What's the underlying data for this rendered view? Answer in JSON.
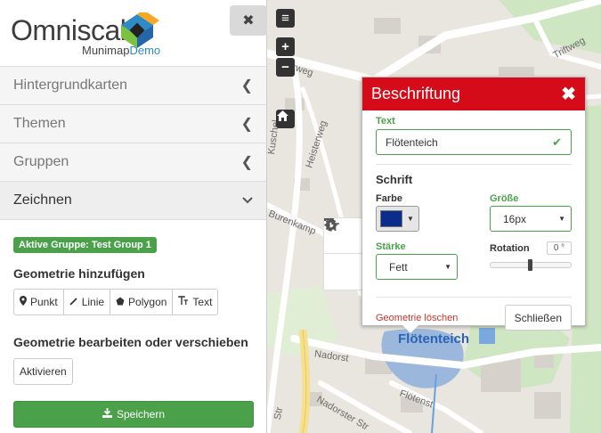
{
  "app": {
    "logo_main": "Omniscale",
    "logo_sub_prefix": "Munimap",
    "logo_sub_suffix": "Demo"
  },
  "colors": {
    "accent_red": "#d60b19",
    "success_green": "#4aa14a",
    "selected_color": "#0b2c8a"
  },
  "sidebar": {
    "close_icon": "times-icon",
    "sections": [
      {
        "label": "Hintergrundkarten",
        "icon": "chevron-left-icon"
      },
      {
        "label": "Themen",
        "icon": "chevron-left-icon"
      },
      {
        "label": "Gruppen",
        "icon": "chevron-left-icon"
      },
      {
        "label": "Zeichnen",
        "icon": "chevron-down-icon"
      }
    ],
    "draw": {
      "active_group_badge": "Aktive Gruppe: Test Group 1",
      "add_title": "Geometrie hinzufügen",
      "add_buttons": [
        {
          "label": "Punkt",
          "icon": "map-marker-icon"
        },
        {
          "label": "Linie",
          "icon": "pencil-icon"
        },
        {
          "label": "Polygon",
          "icon": "pentagon-icon"
        },
        {
          "label": "Text",
          "icon": "text-size-icon"
        }
      ],
      "edit_title": "Geometrie bearbeiten oder verschieben",
      "activate_label": "Aktivieren",
      "save_label": "Speichern"
    }
  },
  "map": {
    "labels": {
      "triftweg": "Triftweg",
      "rweg": "rweg",
      "heisterweg": "Heisterweg",
      "kuschel": "Kuschel",
      "burenkamp": "Burenkamp",
      "nadorst": "Nadorst",
      "nadorster_str": "Nadorster Str",
      "floetenst": "Flötenst",
      "str": "Str",
      "feature": "Flötenteich"
    },
    "controls": [
      "menu-icon",
      "zoom-in-icon",
      "zoom-out-icon",
      "home-icon"
    ],
    "side_tools": [
      "gear-icon",
      "text-size-icon"
    ]
  },
  "dialog": {
    "title": "Beschriftung",
    "text_label": "Text",
    "text_value": "Flötenteich",
    "font_section": "Schrift",
    "color_label": "Farbe",
    "size_label": "Größe",
    "size_value": "16px",
    "weight_label": "Stärke",
    "weight_value": "Fett",
    "rotation_label": "Rotation",
    "rotation_value": "0 °",
    "rotation_level": 0.5,
    "delete_label": "Geometrie löschen",
    "close_label": "Schließen"
  }
}
